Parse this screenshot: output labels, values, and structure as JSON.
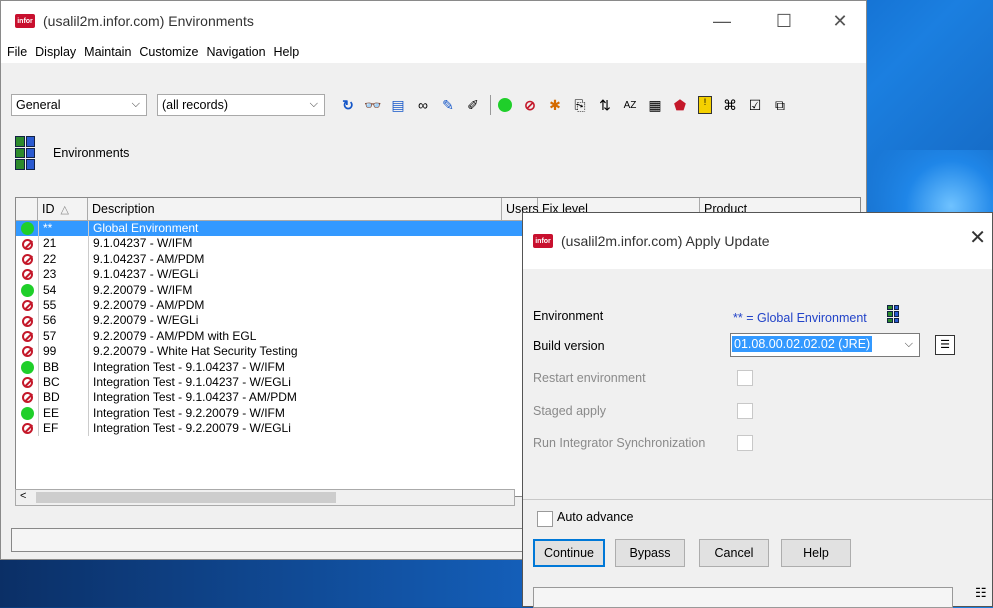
{
  "colors": {
    "accent": "#3399ff",
    "brand": "#c8102e",
    "status_ok": "#1fcf2a",
    "status_error": "#c4182a",
    "link_blue": "#2243c8"
  },
  "main_window": {
    "logo_text": "infor",
    "title": "(usalil2m.infor.com) Environments",
    "menu": [
      "File",
      "Display",
      "Maintain",
      "Customize",
      "Navigation",
      "Help"
    ],
    "filter_combo": "General",
    "records_combo": "(all records)",
    "header_title": "Environments",
    "columns": {
      "id": "ID",
      "description": "Description",
      "users": "Users",
      "fix_level": "Fix level",
      "product": "Product"
    },
    "rows": [
      {
        "status": "ok",
        "id": "**",
        "description": "Global Environment"
      },
      {
        "status": "error",
        "id": "21",
        "description": "9.1.04237 - W/IFM"
      },
      {
        "status": "error",
        "id": "22",
        "description": "9.1.04237 - AM/PDM"
      },
      {
        "status": "error",
        "id": "23",
        "description": "9.1.04237 - W/EGLi"
      },
      {
        "status": "ok",
        "id": "54",
        "description": "9.2.20079 - W/IFM"
      },
      {
        "status": "error",
        "id": "55",
        "description": "9.2.20079 - AM/PDM"
      },
      {
        "status": "error",
        "id": "56",
        "description": "9.2.20079 - W/EGLi"
      },
      {
        "status": "error",
        "id": "57",
        "description": "9.2.20079 - AM/PDM with EGL"
      },
      {
        "status": "error",
        "id": "99",
        "description": "9.2.20079 - White Hat Security Testing"
      },
      {
        "status": "ok",
        "id": "BB",
        "description": "Integration Test - 9.1.04237 - W/IFM"
      },
      {
        "status": "error",
        "id": "BC",
        "description": "Integration Test - 9.1.04237 - W/EGLi"
      },
      {
        "status": "error",
        "id": "BD",
        "description": "Integration Test - 9.1.04237 - AM/PDM"
      },
      {
        "status": "ok",
        "id": "EE",
        "description": "Integration Test - 9.2.20079 - W/IFM"
      },
      {
        "status": "error",
        "id": "EF",
        "description": "Integration Test - 9.2.20079 - W/EGLi"
      }
    ],
    "selected_row": "0"
  },
  "dialog": {
    "logo_text": "infor",
    "title": "(usalil2m.infor.com) Apply Update",
    "environment_label": "Environment",
    "environment_value": "** = Global Environment",
    "build_label": "Build version",
    "build_value": "01.08.00.02.02.02  (JRE)",
    "restart_label": "Restart environment",
    "staged_label": "Staged apply",
    "integrator_label": "Run Integrator Synchronization",
    "auto_advance_label": "Auto advance",
    "buttons": {
      "continue": "Continue",
      "bypass": "Bypass",
      "cancel": "Cancel",
      "help": "Help"
    }
  }
}
